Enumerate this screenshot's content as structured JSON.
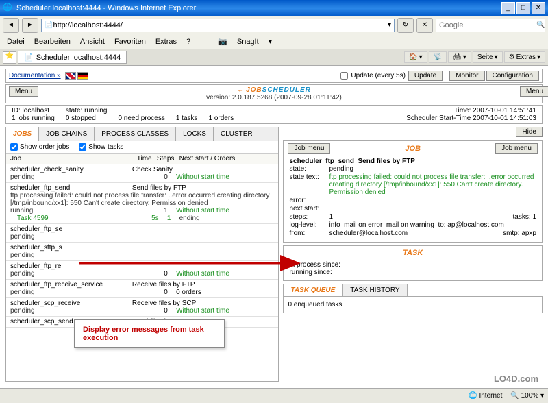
{
  "window": {
    "title": "Scheduler localhost:4444 - Windows Internet Explorer",
    "min": "_",
    "max": "□",
    "close": "✕"
  },
  "nav": {
    "url": "http://localhost:4444/",
    "search_placeholder": "Google"
  },
  "menubar": {
    "datei": "Datei",
    "bearbeiten": "Bearbeiten",
    "ansicht": "Ansicht",
    "favoriten": "Favoriten",
    "extras": "Extras",
    "help": "?",
    "snagit": "SnagIt",
    "snagit_icon": "📷"
  },
  "tabrow": {
    "tab_label": "Scheduler localhost:4444",
    "home": "🏠",
    "print": "🖨",
    "page": "Seite",
    "extras_t": "Extras"
  },
  "docbar": {
    "documentation": "Documentation »",
    "update_label": "Update (every 5s)",
    "update_btn": "Update",
    "monitor": "Monitor",
    "configuration": "Configuration"
  },
  "header": {
    "menu": "Menu",
    "logo_arrow": "←",
    "logo_job": "JOB",
    "logo_sched": "SCHEDULER",
    "version_label": "version: 2.0.187.5268 (2007-09-28 01:11:42)"
  },
  "statbar": {
    "id_label": "ID: localhost",
    "jobs": "1 jobs running",
    "state": "state: running",
    "stopped": "0 stopped",
    "need": "0 need process",
    "tasks": "1 tasks",
    "orders": "1 orders",
    "time": "Time: 2007-10-01 14:51:41",
    "start": "Scheduler Start-Time 2007-10-01 14:51:03"
  },
  "tabs": {
    "jobs": "JOBS",
    "chains": "JOB CHAINS",
    "process": "PROCESS CLASSES",
    "locks": "LOCKS",
    "cluster": "CLUSTER",
    "hide": "Hide"
  },
  "filter": {
    "order": "Show order jobs",
    "tasks": "Show tasks"
  },
  "jobhdr": {
    "job": "Job",
    "time": "Time",
    "steps": "Steps",
    "next": "Next start / Orders"
  },
  "jobs": [
    {
      "name": "scheduler_check_sanity",
      "desc": "Check Sanity",
      "state": "pending",
      "count": "0",
      "link": "Without start time",
      "link_cls": "green"
    },
    {
      "name": "scheduler_ftp_send",
      "desc": "Send files by FTP",
      "state": "running",
      "err": "ftp processing failed: could not process file transfer: ..error occurred creating directory [/tmp/inbound/xx1]: 550 Can't create directory. Permission denied",
      "count": "1",
      "link": "Without start time",
      "link_cls": "green",
      "task_label": "Task 4599",
      "task_time": "5s",
      "task_steps": "1",
      "task_state": "ending"
    },
    {
      "name": "scheduler_ftp_se",
      "desc": "",
      "state": "pending",
      "count": "",
      "link": "",
      "link_cls": ""
    },
    {
      "name": "scheduler_sftp_s",
      "desc": "",
      "state": "pending",
      "count": "",
      "link": "",
      "link_cls": ""
    },
    {
      "name": "scheduler_ftp_re",
      "desc": "",
      "state": "pending",
      "count": "0",
      "link": "Without start time",
      "link_cls": "green"
    },
    {
      "name": "scheduler_ftp_receive_service",
      "desc": "Receive files by FTP",
      "state": "pending",
      "count": "0",
      "link": "0 orders",
      "link_cls": "black"
    },
    {
      "name": "scheduler_scp_receive",
      "desc": "Receive files by SCP",
      "state": "pending",
      "count": "0",
      "link": "Without start time",
      "link_cls": "green"
    },
    {
      "name": "scheduler_scp_send",
      "desc": "Send files by SCP",
      "state": "",
      "count": "",
      "link": "",
      "link_cls": ""
    }
  ],
  "jobpanel": {
    "menu": "Job menu",
    "title": "JOB",
    "name": "scheduler_ftp_send",
    "desc": "Send files by FTP",
    "state_l": "state:",
    "state_v": "pending",
    "text_l": "state text:",
    "text_v": "ftp processing failed: could not process file transfer: ..error occurred creating directory [/tmp/inbound/xx1]: 550 Can't create directory. Permission denied",
    "error_l": "error:",
    "next_l": "next start:",
    "steps_l": "steps:",
    "steps_v": "1",
    "tasks_l": "tasks:",
    "tasks_v": "1",
    "log_l": "log-level:",
    "log_v": "info",
    "mail_err": "mail on error",
    "mail_warn": "mail on warning",
    "to_l": "to:",
    "to_v": "ap@localhost.com",
    "from_l": "from:",
    "from_v": "scheduler@localhost.com",
    "smtp_l": "smtp:",
    "smtp_v": "apxp"
  },
  "taskpanel": {
    "title": "TASK",
    "inproc": "in process since:",
    "running": "running since:"
  },
  "queue": {
    "tab_q": "TASK QUEUE",
    "tab_h": "TASK HISTORY",
    "body": "0 enqueued tasks"
  },
  "annotation": "Display error messages from task execution",
  "statusbar": {
    "internet": "Internet",
    "zoom": "100%",
    "globe": "🌐"
  },
  "watermark": "LO4D.com"
}
